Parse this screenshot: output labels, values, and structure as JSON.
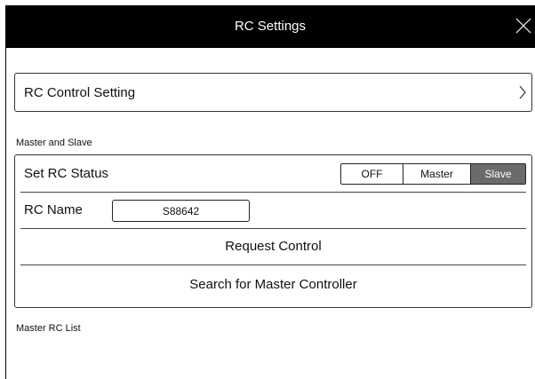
{
  "window": {
    "title": "RC Settings",
    "close_icon": "close-icon"
  },
  "control_setting": {
    "label": "RC Control Setting",
    "icon": "chevron-right-icon"
  },
  "master_slave": {
    "section_label": "Master and Slave",
    "status": {
      "label": "Set RC Status",
      "options": [
        "OFF",
        "Master",
        "Slave"
      ],
      "selected": "Slave"
    },
    "name": {
      "label": "RC Name",
      "value": "S88642"
    },
    "request_control_label": "Request Control",
    "search_master_label": "Search for Master Controller"
  },
  "master_list": {
    "section_label": "Master RC List"
  },
  "colors": {
    "titlebar": "#000000",
    "selected_segment": "#6b6b6b"
  }
}
